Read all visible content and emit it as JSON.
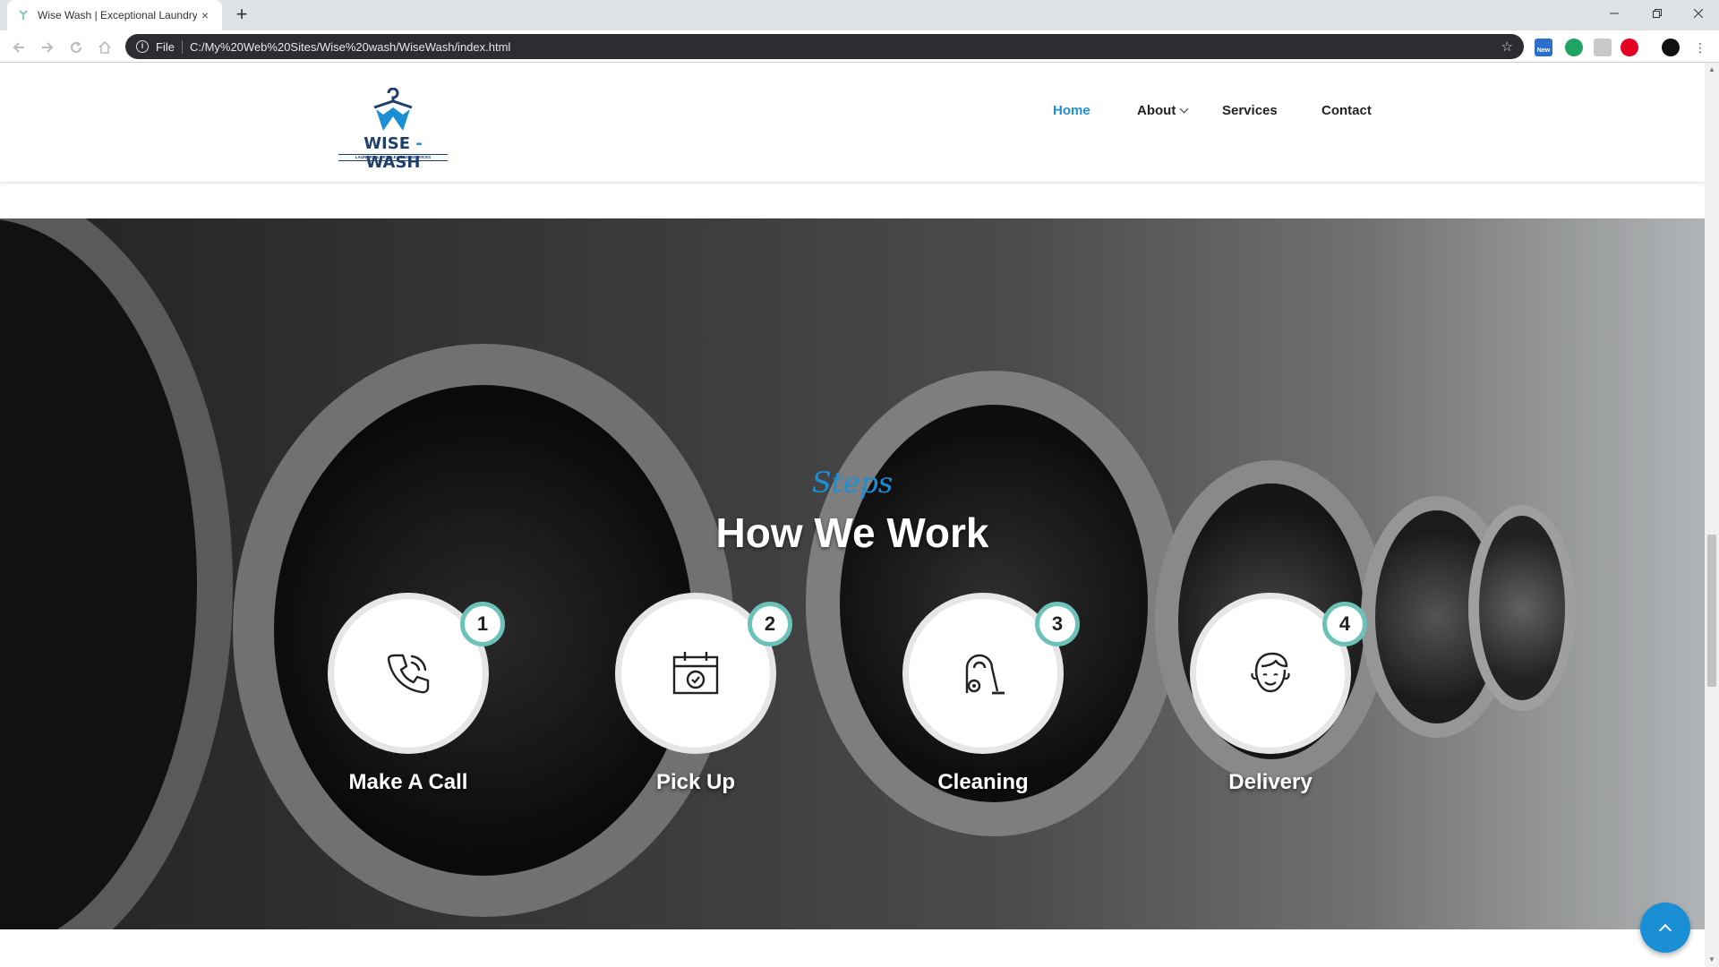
{
  "browser": {
    "tab_title": "Wise Wash | Exceptional Laundry",
    "tab_close": "×",
    "new_tab": "+",
    "omnibox_scheme": "File",
    "omnibox_url": "C:/My%20Web%20Sites/Wise%20wash/WiseWash/index.html",
    "ext_badge": "New"
  },
  "site": {
    "logo_main": "WISE",
    "logo_dash": "-",
    "logo_second": "WASH",
    "logo_sub": "LAUNDRY & DRYCLEANING SERVICES",
    "nav": {
      "home": "Home",
      "about": "About",
      "services": "Services",
      "contact": "Contact"
    }
  },
  "how_we_work": {
    "subtitle": "Steps",
    "title": "How We Work",
    "steps": [
      {
        "number": "1",
        "label": "Make A Call",
        "icon": "phone-icon"
      },
      {
        "number": "2",
        "label": "Pick Up",
        "icon": "calendar-icon"
      },
      {
        "number": "3",
        "label": "Cleaning",
        "icon": "vacuum-icon"
      },
      {
        "number": "4",
        "label": "Delivery",
        "icon": "delivery-person-icon"
      }
    ]
  },
  "colors": {
    "accent_blue": "#1a8fd6",
    "step_ring": "#6cc1b8",
    "logo_navy": "#1f3f6e"
  }
}
